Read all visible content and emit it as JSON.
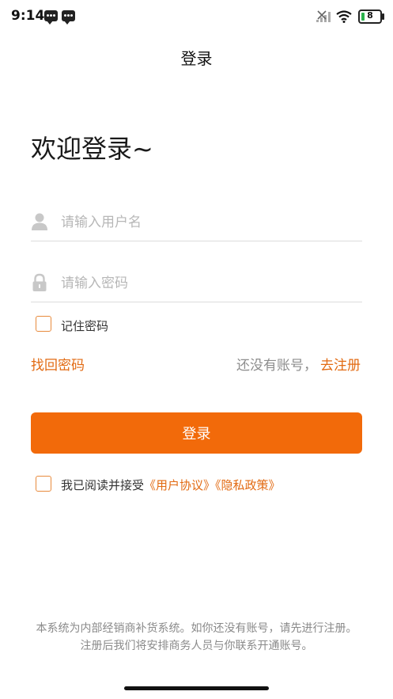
{
  "status_bar": {
    "time": "9:14",
    "battery_level": "8",
    "icons": [
      "message-icon",
      "message-icon",
      "no-sim-signal-icon",
      "wifi-icon",
      "battery-icon"
    ]
  },
  "header": {
    "title": "登录"
  },
  "welcome_text": "欢迎登录~",
  "form": {
    "username_placeholder": "请输入用户名",
    "username_value": "",
    "password_placeholder": "请输入密码",
    "password_value": "",
    "remember_label": "记住密码",
    "remember_checked": false,
    "forgot_password": "找回密码",
    "no_account_text": "还没有账号，",
    "register_link": "去注册",
    "login_button": "登录"
  },
  "agreement": {
    "prefix": "我已阅读并接受",
    "user_agreement": "《用户协议》",
    "privacy_policy": "《隐私政策》",
    "checked": false
  },
  "footer": {
    "notice": "本系统为内部经销商补货系统。如你还没有账号，请先进行注册。注册后我们将安排商务人员与你联系开通账号。"
  },
  "colors": {
    "accent": "#f26a0a",
    "link": "#e26a12",
    "checkbox_border": "#e88a3c",
    "placeholder": "#b7b7b7",
    "muted_text": "#8a8a8a"
  }
}
